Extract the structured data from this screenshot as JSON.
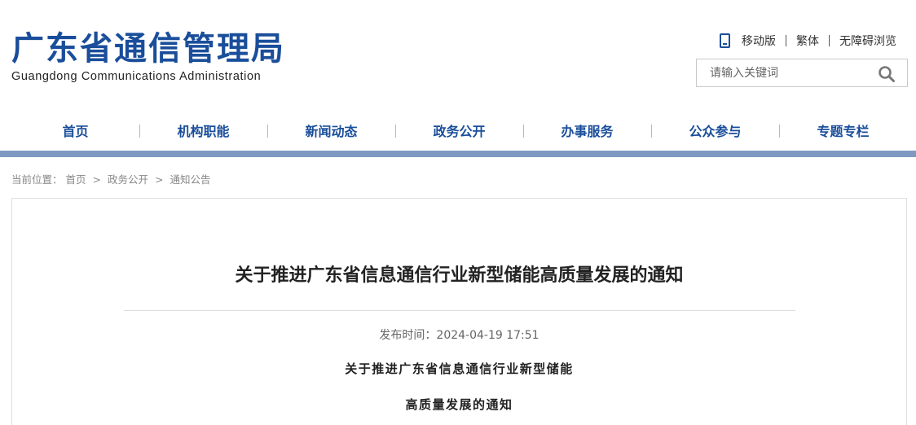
{
  "header": {
    "logo_cn": "广东省通信管理局",
    "logo_en": "Guangdong Communications Administration",
    "brand_color": "#1a4e9a",
    "links": {
      "mobile": "移动版",
      "traditional": "繁体",
      "accessible": "无障碍浏览"
    },
    "search": {
      "placeholder": "请输入关键词"
    }
  },
  "nav": {
    "bar_color": "#7f99c3",
    "items": [
      {
        "label": "首页"
      },
      {
        "label": "机构职能"
      },
      {
        "label": "新闻动态"
      },
      {
        "label": "政务公开"
      },
      {
        "label": "办事服务"
      },
      {
        "label": "公众参与"
      },
      {
        "label": "专题专栏"
      }
    ]
  },
  "breadcrumb": {
    "prefix": "当前位置：",
    "items": [
      "首页",
      "政务公开",
      "通知公告"
    ],
    "separator": ">"
  },
  "article": {
    "title": "关于推进广东省信息通信行业新型储能高质量发展的通知",
    "pub_label": "发布时间：",
    "pub_time": "2024-04-19 17:51",
    "body_line_1": "关于推进广东省信息通信行业新型储能",
    "body_line_2": "高质量发展的通知"
  }
}
